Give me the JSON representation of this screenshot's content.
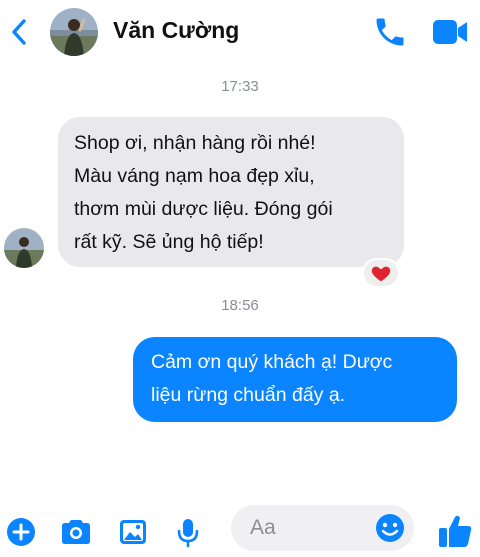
{
  "header": {
    "contact_name": "Văn Cường",
    "icons": {
      "back": "chevron-left-icon",
      "call": "phone-icon",
      "video": "video-camera-icon"
    },
    "accent_color": "#0b84ff"
  },
  "messages": [
    {
      "type": "timestamp",
      "text": "17:33"
    },
    {
      "type": "incoming",
      "lines": [
        "Shop ơi, nhận hàng rồi nhé!",
        "Màu váng nạm hoa đẹp xỉu,",
        "thơm mùi dược liệu. Đóng gói",
        "rất kỹ. Sẽ ủng hộ tiếp!"
      ],
      "reaction": "heart-icon"
    },
    {
      "type": "timestamp",
      "text": "18:56"
    },
    {
      "type": "outgoing",
      "lines": [
        "Cảm ơn quý khách ạ! Dược",
        "liệu rừng chuẩn đấy ạ."
      ]
    }
  ],
  "composer": {
    "placeholder": "Aa",
    "icons": [
      "plus-circle-icon",
      "camera-icon",
      "photo-icon",
      "microphone-icon",
      "emoji-icon",
      "thumbs-up-icon"
    ]
  }
}
